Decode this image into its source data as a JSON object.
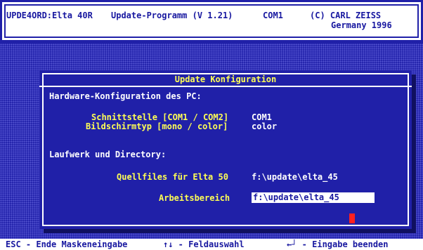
{
  "header": {
    "program_title": "UPDE4ORD:Elta 40R",
    "program_subtitle": "Update-Programm (V 1.21)",
    "port": "COM1",
    "copyright_line1": "(C) CARL ZEISS",
    "copyright_line2": "Germany 1996"
  },
  "dialog": {
    "title": "Update Konfiguration",
    "hardware_heading": "Hardware-Konfiguration des PC:",
    "interface_label": "Schnittstelle [COM1 / COM2]",
    "interface_value": "COM1",
    "display_label": "Bildschirmtyp [mono / color]",
    "display_value": "color",
    "drive_heading": "Laufwerk und Directory:",
    "source_label": "Quellfiles für Elta 50",
    "source_value": "f:\\update\\elta_45",
    "workspace_label": "Arbeitsbereich",
    "workspace_value": "f:\\update\\elta_45"
  },
  "footer": {
    "esc_hint": "ESC - Ende Maskeneingabe",
    "arrows_hint": "↑↓ - Feldauswahl",
    "enter_hint": "←┘ - Eingabe beenden"
  },
  "colors": {
    "background": "#2020a8",
    "highlight": "#ffff55",
    "text": "#ffffff",
    "cursor": "#ff2020"
  }
}
